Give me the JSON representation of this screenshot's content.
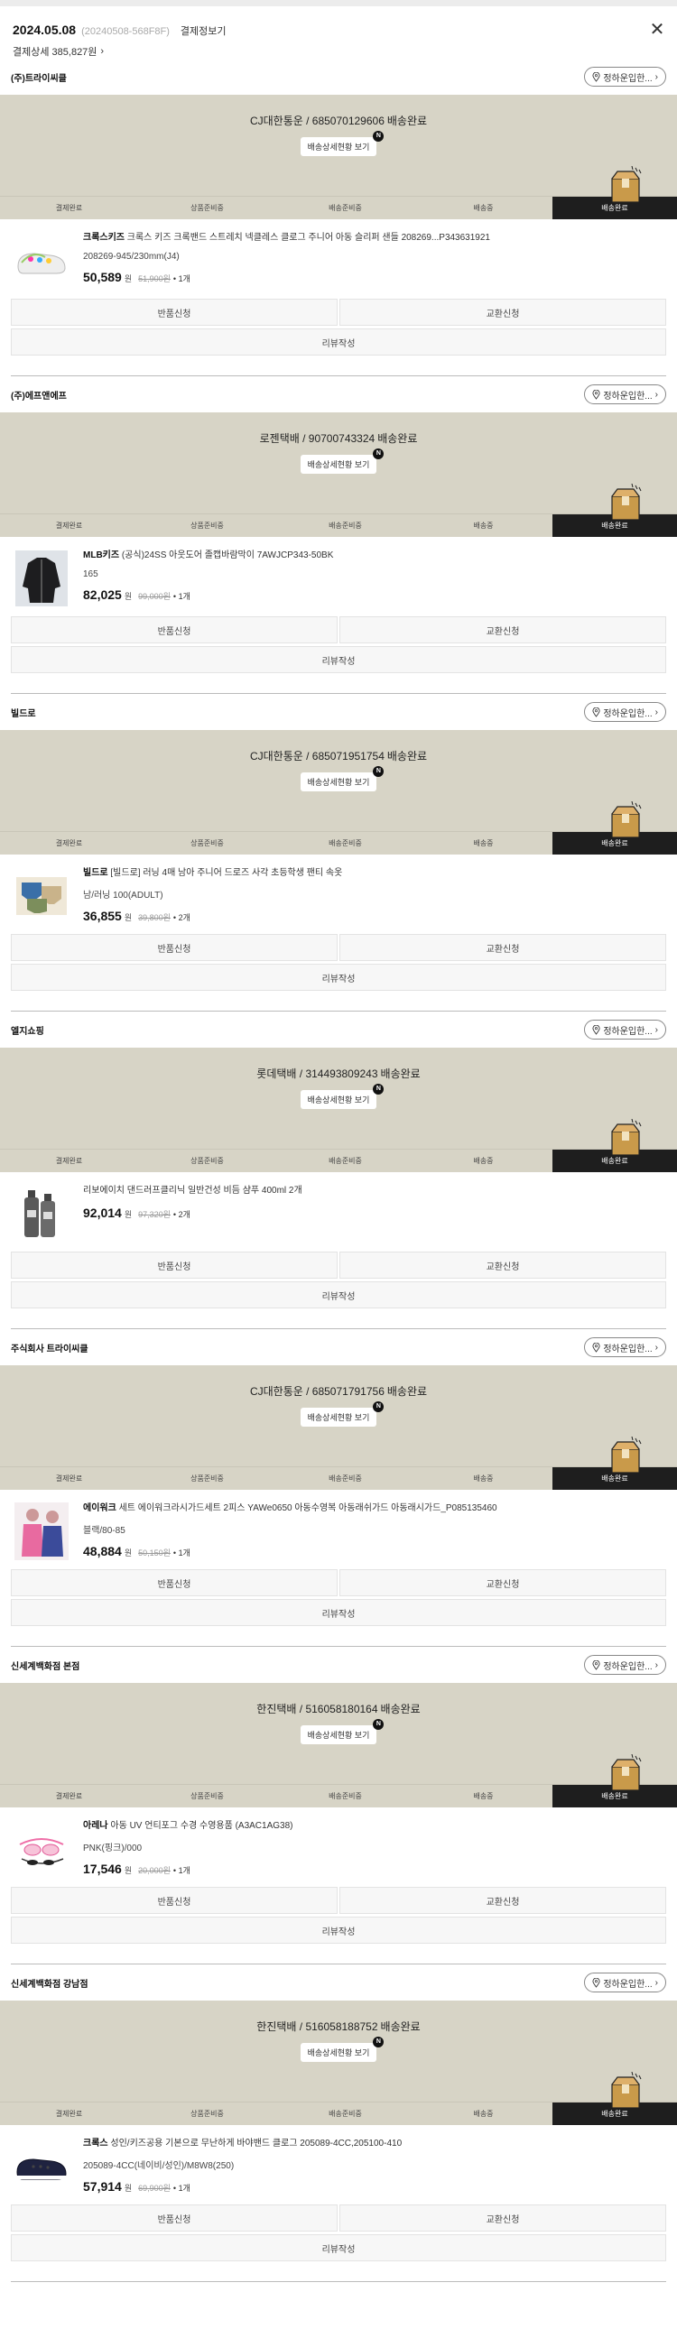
{
  "header": {
    "date": "2024.05.08",
    "order_no": "(20240508-568F8F)",
    "receipt_label": "결제정보기",
    "payment_label": "결제상세 385,827원",
    "close_icon": "close-icon"
  },
  "common": {
    "refund_label": "정하운입한...",
    "view_label": "배송상세현황 보기",
    "new_badge": "N",
    "steps": [
      "결제완료",
      "상품준비중",
      "배송준비중",
      "배송중",
      "배송완료"
    ],
    "return_label": "반품신청",
    "exchange_label": "교환신청",
    "review_label": "리뷰작성",
    "won": "원"
  },
  "colors": {
    "banner": "#d7d4c6",
    "active_step": "#1e1e1e"
  },
  "orders": [
    {
      "seller": "(주)트라이씨클",
      "tracking": "CJ대한통운 / 685070129606",
      "status": "배송완료",
      "brand": "크록스키즈",
      "title": "크록스 키즈 크록밴드 스트레치 넥클레스 클로그 주니어 아동 슬리퍼 샌들 208269...P343631921",
      "option": "208269-945/230mm(J4)",
      "price": "50,589",
      "orig": "51,900원",
      "qty": "1개",
      "thumb": "clog-shoe"
    },
    {
      "seller": "(주)에프앤에프",
      "tracking": "로젠택배 / 90700743324",
      "status": "배송완료",
      "brand": "MLB키즈",
      "title": "(공식)24SS 아웃도어 졸캡바람막이 7AWJCP343-50BK",
      "option": "165",
      "price": "82,025",
      "orig": "99,000원",
      "qty": "1개",
      "thumb": "jacket"
    },
    {
      "seller": "빌드로",
      "tracking": "CJ대한통운 / 685071951754",
      "status": "배송완료",
      "brand": "빌드로",
      "title": "[빌드로] 러닝 4매 남아 주니어 드로즈 사각 초등학생 팬티 속옷",
      "option": "남/러닝 100(ADULT)",
      "price": "36,855",
      "orig": "39,800원",
      "qty": "2개",
      "thumb": "underwear"
    },
    {
      "seller": "엘지쇼핑",
      "tracking": "롯데택배 / 314493809243",
      "status": "배송완료",
      "brand": "",
      "title": "리보에이치 댄드러프클리닉 일반건성 비듬 샴푸 400ml 2개",
      "option": "",
      "price": "92,014",
      "orig": "97,320원",
      "qty": "2개",
      "thumb": "shampoo"
    },
    {
      "seller": "주식회사 트라이씨클",
      "tracking": "CJ대한통운 / 685071791756",
      "status": "배송완료",
      "brand": "에이워크",
      "title": "세트 에이워크라시가드세트 2피스 YAWe0650 아동수영복 아동래쉬가드 아동래시가드_P085135460",
      "option": "블랙/80-85",
      "price": "48,884",
      "orig": "50,150원",
      "qty": "1개",
      "thumb": "kids"
    },
    {
      "seller": "신세계백화점 본점",
      "tracking": "한진택배 / 516058180164",
      "status": "배송완료",
      "brand": "아레나",
      "title": "아동 UV 언티포그 수경 수영용품 (A3AC1AG38)",
      "option": "PNK(핑크)/000",
      "price": "17,546",
      "orig": "20,000원",
      "qty": "1개",
      "thumb": "goggles"
    },
    {
      "seller": "신세계백화점 강남점",
      "tracking": "한진택배 / 516058188752",
      "status": "배송완료",
      "brand": "크록스",
      "title": "성인/키즈공용 기본으로 무난하게 바야밴드 클로그 205089-4CC,205100-410",
      "option": "205089-4CC(네이비/성인)/M8W8(250)",
      "price": "57,914",
      "orig": "69,900원",
      "qty": "1개",
      "thumb": "clog-navy"
    }
  ]
}
